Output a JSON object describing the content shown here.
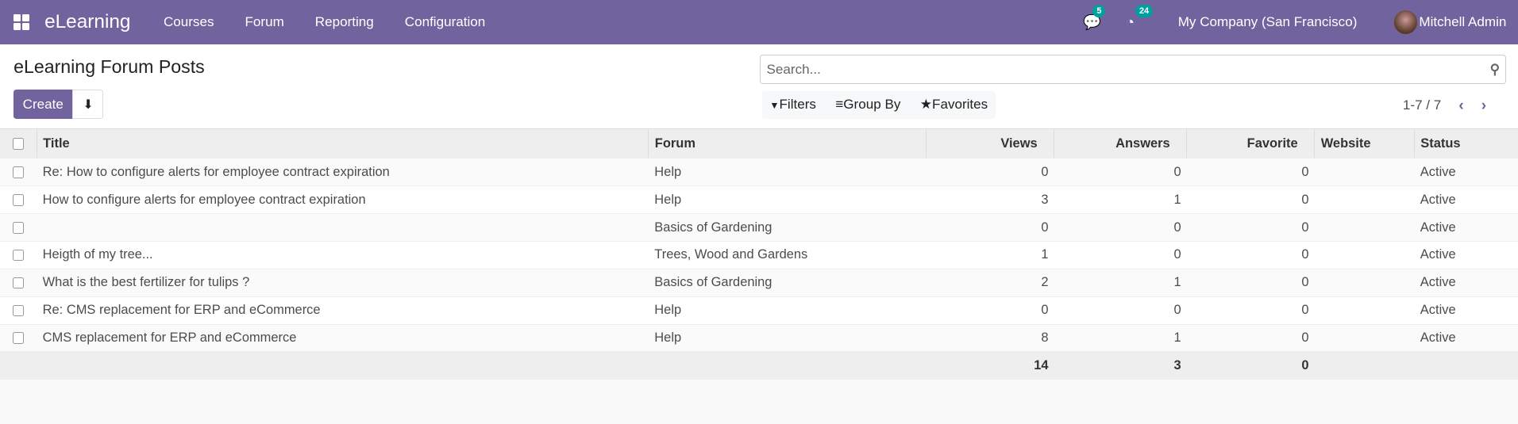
{
  "navbar": {
    "brand": "eLearning",
    "menu": [
      "Courses",
      "Forum",
      "Reporting",
      "Configuration"
    ],
    "messages_count": "5",
    "activities_count": "24",
    "company": "My Company (San Francisco)",
    "user": "Mitchell Admin",
    "color": "#71639e"
  },
  "control_panel": {
    "title": "eLearning Forum Posts",
    "create_label": "Create",
    "search_placeholder": "Search...",
    "filters_label": "Filters",
    "group_by_label": "Group By",
    "favorites_label": "Favorites",
    "pager": "1-7 / 7"
  },
  "table": {
    "columns": [
      "Title",
      "Forum",
      "Views",
      "Answers",
      "Favorite",
      "Website",
      "Status"
    ],
    "rows": [
      [
        "Re: How to configure alerts for employee contract expiration",
        "Help",
        "0",
        "0",
        "0",
        "",
        "Active"
      ],
      [
        "How to configure alerts for employee contract expiration",
        "Help",
        "3",
        "1",
        "0",
        "",
        "Active"
      ],
      [
        "",
        "Basics of Gardening",
        "0",
        "0",
        "0",
        "",
        "Active"
      ],
      [
        "Heigth of my tree...",
        "Trees, Wood and Gardens",
        "1",
        "0",
        "0",
        "",
        "Active"
      ],
      [
        "What is the best fertilizer for tulips ?",
        "Basics of Gardening",
        "2",
        "1",
        "0",
        "",
        "Active"
      ],
      [
        "Re: CMS replacement for ERP and eCommerce",
        "Help",
        "0",
        "0",
        "0",
        "",
        "Active"
      ],
      [
        "CMS replacement for ERP and eCommerce",
        "Help",
        "8",
        "1",
        "0",
        "",
        "Active"
      ]
    ],
    "totals": {
      "views": "14",
      "answers": "3",
      "favorite": "0"
    }
  }
}
